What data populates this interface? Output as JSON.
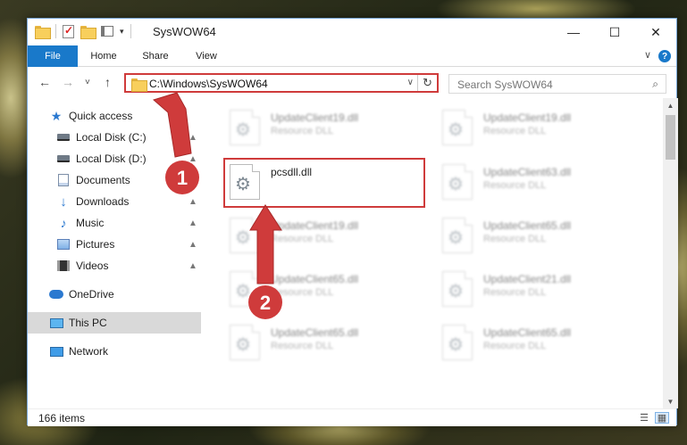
{
  "window": {
    "title": "SysWOW64",
    "minimize_label": "—",
    "maximize_label": "☐",
    "close_label": "✕",
    "qat_dropdown": "▾"
  },
  "ribbon": {
    "tabs": [
      "File",
      "Home",
      "Share",
      "View"
    ],
    "help_label": "?",
    "collapse_label": "∨"
  },
  "nav": {
    "back": "←",
    "forward": "→",
    "recent": "˅",
    "up": "↑",
    "address": "C:\\Windows\\SysWOW64",
    "address_dropdown": "∨",
    "refresh": "↻",
    "search_placeholder": "Search SysWOW64",
    "search_icon": "⌕"
  },
  "sidebar": {
    "items": [
      {
        "label": "Quick access",
        "icon": "star-icon",
        "pinned": false
      },
      {
        "label": "Local Disk (C:)",
        "icon": "drive-icon",
        "pinned": true
      },
      {
        "label": "Local Disk (D:)",
        "icon": "drive-icon",
        "pinned": true
      },
      {
        "label": "Documents",
        "icon": "documents-icon",
        "pinned": true
      },
      {
        "label": "Downloads",
        "icon": "downloads-icon",
        "pinned": true
      },
      {
        "label": "Music",
        "icon": "music-icon",
        "pinned": true
      },
      {
        "label": "Pictures",
        "icon": "pictures-icon",
        "pinned": true
      },
      {
        "label": "Videos",
        "icon": "videos-icon",
        "pinned": true
      },
      {
        "label": "OneDrive",
        "icon": "onedrive-icon",
        "pinned": false
      },
      {
        "label": "This PC",
        "icon": "this-pc-icon",
        "pinned": false,
        "selected": true
      },
      {
        "label": "Network",
        "icon": "network-icon",
        "pinned": false
      }
    ],
    "pin_glyph": "📌"
  },
  "files": {
    "left": [
      {
        "name": "UpdateClient19.dll",
        "type": "Resource DLL"
      },
      {
        "name": "pcsdll.dll",
        "type": ""
      },
      {
        "name": "UpdateClient19.dll",
        "type": "Resource DLL"
      },
      {
        "name": "UpdateClient65.dll",
        "type": "Resource DLL"
      },
      {
        "name": "UpdateClient65.dll",
        "type": "Resource DLL"
      }
    ],
    "right": [
      {
        "name": "UpdateClient19.dll",
        "type": "Resource DLL"
      },
      {
        "name": "UpdateClient63.dll",
        "type": "Resource DLL"
      },
      {
        "name": "UpdateClient65.dll",
        "type": "Resource DLL"
      },
      {
        "name": "UpdateClient21.dll",
        "type": "Resource DLL"
      },
      {
        "name": "UpdateClient65.dll",
        "type": "Resource DLL"
      }
    ],
    "gear_glyph": "⚙"
  },
  "scroll": {
    "up": "▲",
    "down": "▼"
  },
  "status": {
    "item_count": "166 items",
    "details_view": "☰",
    "icons_view": "▦"
  },
  "annotations": [
    {
      "number": "1",
      "color": "#cf3b3b"
    },
    {
      "number": "2",
      "color": "#cf3b3b"
    }
  ]
}
